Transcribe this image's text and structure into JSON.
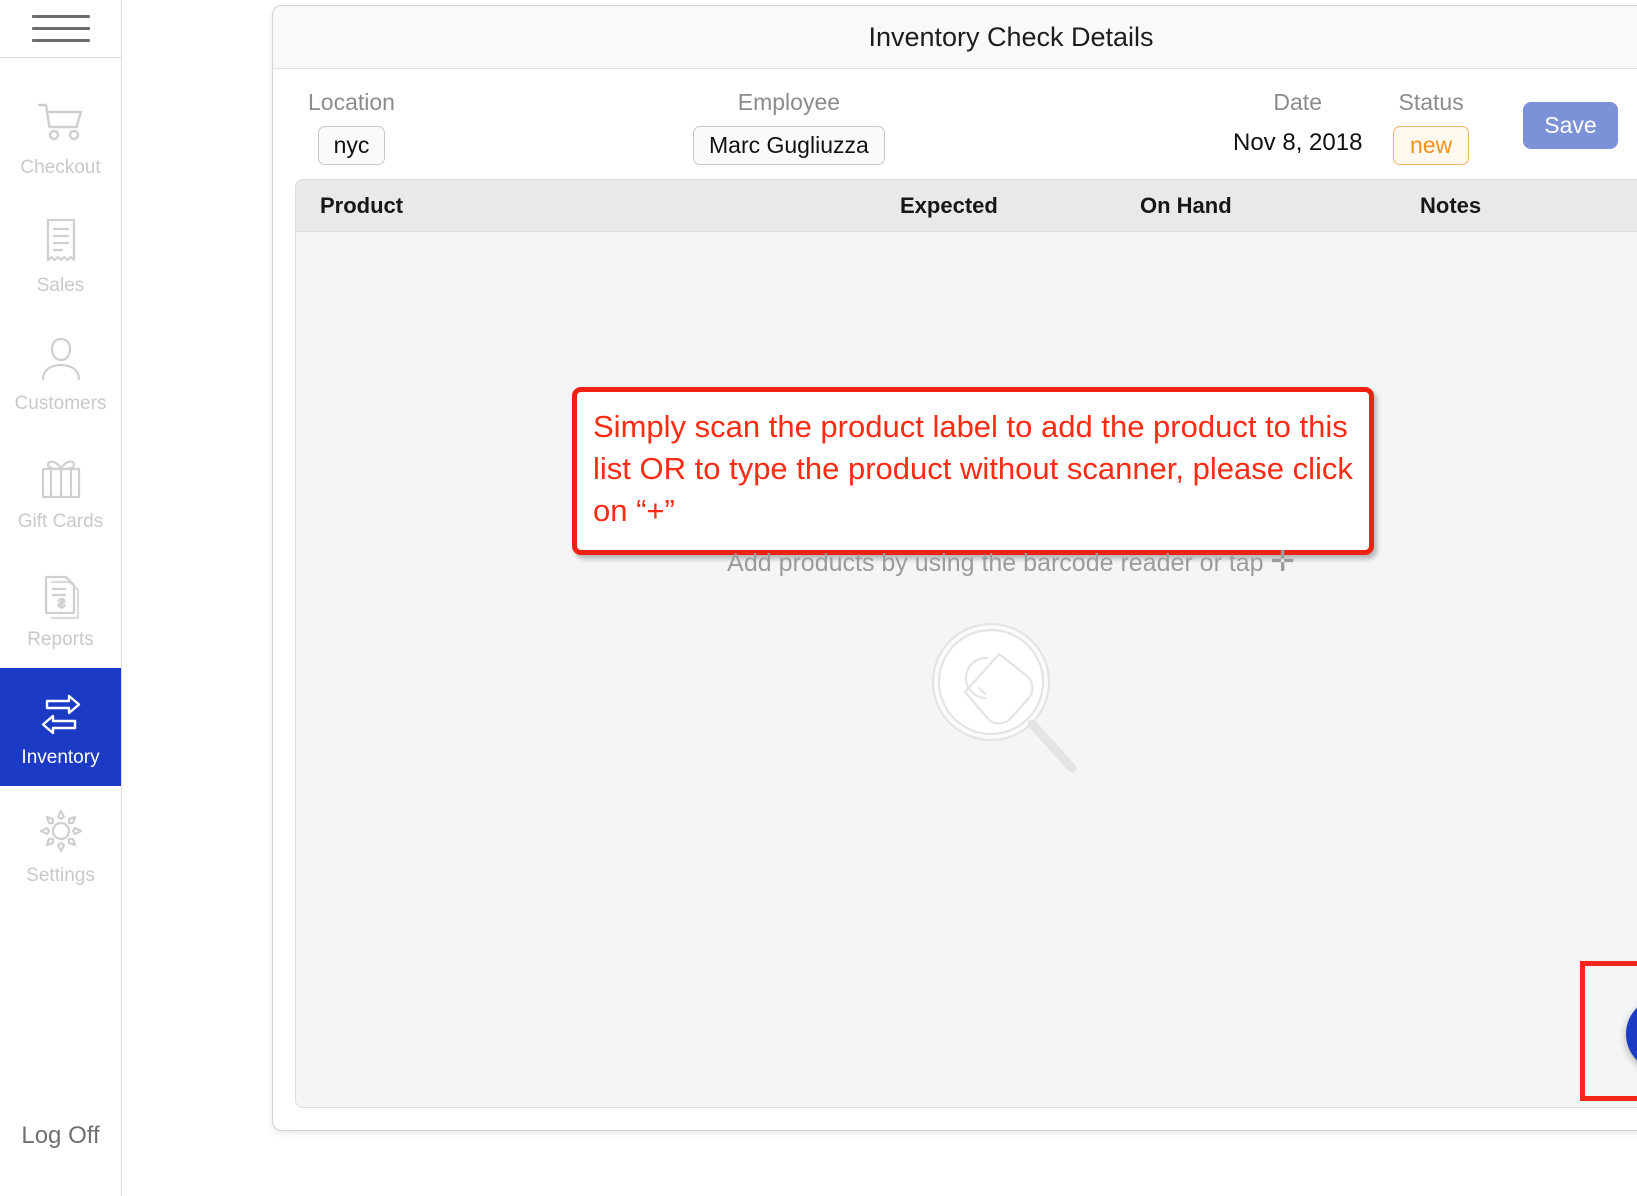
{
  "sidebar": {
    "menu_icon": "hamburger-menu-icon",
    "items": [
      {
        "label": "Checkout",
        "icon": "shopping-cart-icon",
        "active": false
      },
      {
        "label": "Sales",
        "icon": "receipt-icon",
        "active": false
      },
      {
        "label": "Customers",
        "icon": "person-icon",
        "active": false
      },
      {
        "label": "Gift Cards",
        "icon": "gift-box-icon",
        "active": false
      },
      {
        "label": "Reports",
        "icon": "documents-dollar-icon",
        "active": false
      },
      {
        "label": "Inventory",
        "icon": "transfer-arrows-icon",
        "active": true
      },
      {
        "label": "Settings",
        "icon": "gear-icon",
        "active": false
      }
    ],
    "logoff_label": "Log Off",
    "active_color": "#1c3bc4",
    "inactive_color": "#c9c9c9"
  },
  "dialog": {
    "title": "Inventory Check Details",
    "close_icon": "close-x-icon",
    "meta": {
      "location_label": "Location",
      "location_value": "nyc",
      "employee_label": "Employee",
      "employee_value": "Marc Gugliuzza",
      "date_label": "Date",
      "date_value": "Nov 8, 2018",
      "status_label": "Status",
      "status_value": "new",
      "status_color": "#f0921f",
      "save_label": "Save",
      "save_color": "#7b92d6"
    },
    "table": {
      "columns": [
        "Product",
        "Expected",
        "On Hand",
        "Notes"
      ],
      "rows": []
    },
    "empty_state": {
      "hint_text": "Add products by using the barcode reader or tap",
      "hint_plus": "✛",
      "illustration_icon": "magnifier-product-tag-icon"
    },
    "fab": {
      "icon": "plus-icon",
      "color": "#1c3bc4"
    }
  },
  "annotations": {
    "callout_color": "#fb2b14",
    "callout_text": "Simply scan the product label to add the product to this list OR to type the product without scanner, please click on “+”",
    "fab_highlight_color": "#f5271a"
  }
}
